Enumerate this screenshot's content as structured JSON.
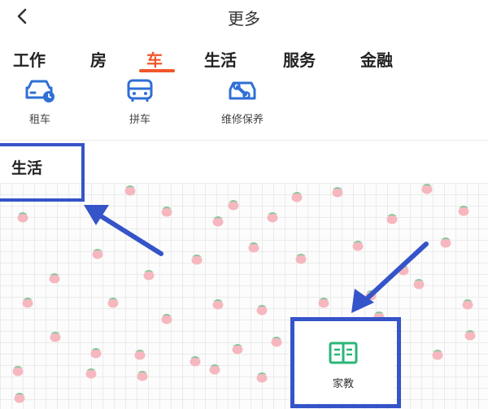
{
  "header": {
    "title": "更多",
    "back_icon": "chevron-left-icon"
  },
  "tabs": [
    {
      "label": "工作",
      "active": false
    },
    {
      "label": "房",
      "active": false
    },
    {
      "label": "车",
      "active": true
    },
    {
      "label": "生活",
      "active": false
    },
    {
      "label": "服务",
      "active": false
    },
    {
      "label": "金融",
      "active": false
    }
  ],
  "services": [
    {
      "label": "租车",
      "icon": "car-clock-icon"
    },
    {
      "label": "拼车",
      "icon": "bus-icon"
    },
    {
      "label": "维修保养",
      "icon": "wrench-car-icon"
    }
  ],
  "section": {
    "title": "生活"
  },
  "life_items": [
    {
      "label": "家教",
      "icon": "open-book-icon"
    }
  ],
  "colors": {
    "accent": "#f0562b",
    "icon_blue": "#2f6fd6",
    "highlight_box": "#3554c9",
    "book_green": "#2ab67a"
  }
}
